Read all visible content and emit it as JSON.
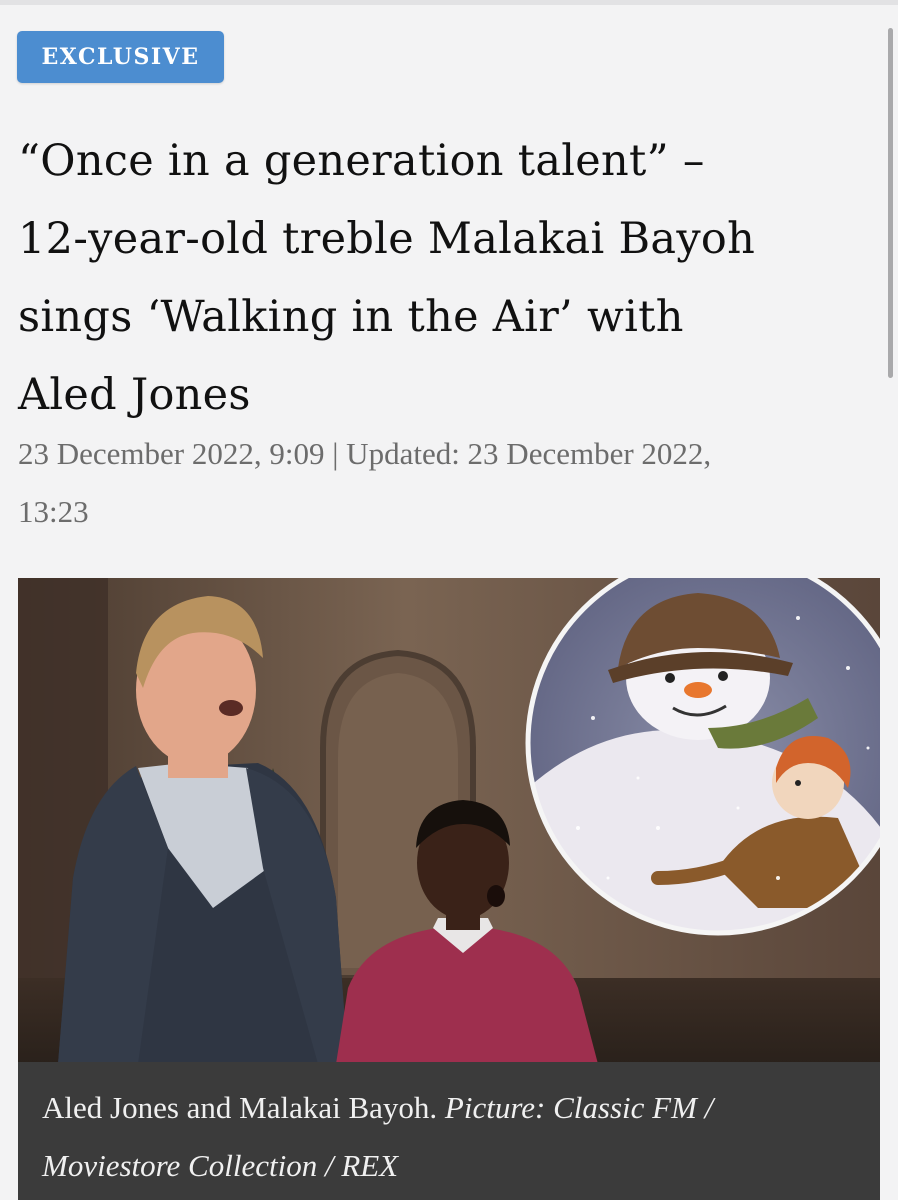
{
  "article": {
    "badge": "EXCLUSIVE",
    "headline_lines": [
      "“Once in a generation talent” –",
      "12-year-old treble Malakai Bayoh",
      "sings ‘Walking in the Air’ with",
      "Aled Jones"
    ],
    "meta_lines": [
      "23 December 2022, 9:09 | Updated: 23 December 2022,",
      "13:23"
    ],
    "caption": {
      "text": "Aled Jones and Malakai Bayoh.",
      "credit_line1": "Picture: Classic FM /",
      "credit_line2": "Moviestore Collection / REX"
    }
  },
  "colors": {
    "background": "#f3f3f4",
    "badge": "#4c8dd0",
    "caption_bg": "#3b3b3b",
    "meta_text": "#6c6c6c"
  }
}
